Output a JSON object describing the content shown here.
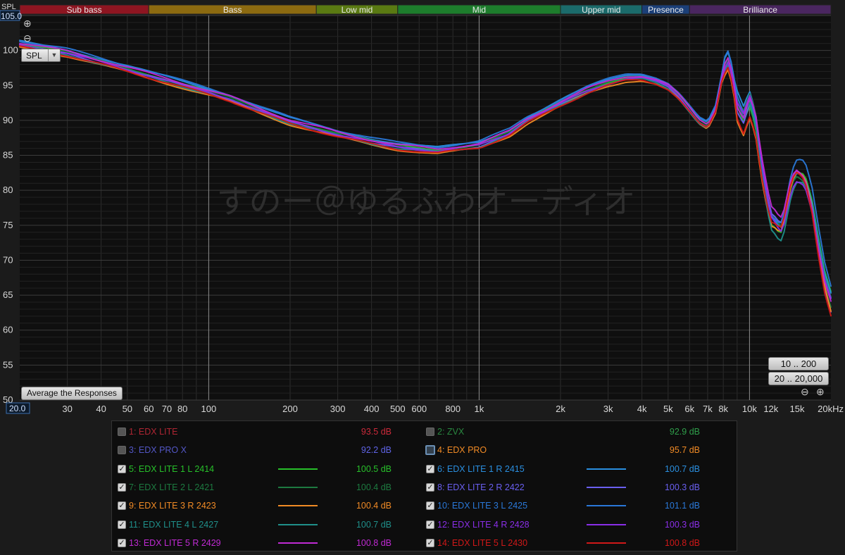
{
  "watermark": "すのー＠ゆるふわオーディオ",
  "bands": [
    {
      "label": "Sub bass",
      "from": 20,
      "to": 60,
      "color": "#8e1521"
    },
    {
      "label": "Bass",
      "from": 60,
      "to": 250,
      "color": "#8c6a10"
    },
    {
      "label": "Low mid",
      "from": 250,
      "to": 500,
      "color": "#5a7a12"
    },
    {
      "label": "Mid",
      "from": 500,
      "to": 2000,
      "color": "#1d7d2c"
    },
    {
      "label": "Upper mid",
      "from": 2000,
      "to": 4000,
      "color": "#1b6b6b"
    },
    {
      "label": "Presence",
      "from": 4000,
      "to": 6000,
      "color": "#1b3f78"
    },
    {
      "label": "Brilliance",
      "from": 6000,
      "to": 20000,
      "color": "#4a2660"
    }
  ],
  "controls": {
    "spl_label": "SPL",
    "average_button": "Average the Responses",
    "range_button_1": "10 .. 200",
    "range_button_2": "20 .. 20,000",
    "zoom_in_icon": "zoom-in-icon",
    "zoom_out_icon": "zoom-out-icon"
  },
  "chart_data": {
    "type": "line",
    "xscale": "log",
    "xlim": [
      20,
      20000
    ],
    "ylim": [
      50,
      105
    ],
    "ylabel": "SPL",
    "y_top_readout": "105.0",
    "x_left_readout": "20.0",
    "y_ticks": [
      "100",
      "95",
      "90",
      "85",
      "80",
      "75",
      "70",
      "65",
      "60",
      "55",
      "50"
    ],
    "y_tick_values": [
      100,
      95,
      90,
      85,
      80,
      75,
      70,
      65,
      60,
      55,
      50
    ],
    "x_tick_labels": [
      "30",
      "40",
      "50",
      "60",
      "70",
      "80",
      "100",
      "200",
      "300",
      "400",
      "500",
      "600",
      "800",
      "1k",
      "2k",
      "3k",
      "4k",
      "5k",
      "6k",
      "7k",
      "8k",
      "10k",
      "12k",
      "15k",
      "20kHz"
    ],
    "x_tick_values": [
      30,
      40,
      50,
      60,
      70,
      80,
      100,
      200,
      300,
      400,
      500,
      600,
      800,
      1000,
      2000,
      3000,
      4000,
      5000,
      6000,
      7000,
      8000,
      10000,
      12000,
      15000,
      20000
    ],
    "base_curve": {
      "x": [
        20,
        30,
        50,
        100,
        120,
        150,
        200,
        300,
        400,
        500,
        700,
        1000,
        1300,
        1500,
        2000,
        2500,
        3000,
        3500,
        4000,
        4500,
        5000,
        5500,
        6000,
        6500,
        7000,
        7500,
        8000,
        8300,
        8600,
        9000,
        9500,
        10000,
        10500,
        11000,
        11500,
        12000,
        12500,
        13000,
        13500,
        14000,
        14500,
        15000,
        16000,
        17000,
        18000,
        19000,
        20000
      ],
      "y": [
        100.8,
        99.6,
        97.3,
        94,
        93.1,
        91.6,
        89.8,
        88,
        86.9,
        86.2,
        85.6,
        86.4,
        88.2,
        89.9,
        92.4,
        94.2,
        95.3,
        96,
        96.1,
        95.6,
        94.8,
        93.3,
        91.5,
        89.8,
        89.1,
        91.5,
        97,
        98.5,
        96.5,
        92,
        90,
        92.5,
        90,
        84,
        79.5,
        75.8,
        75.2,
        74.2,
        76,
        79.5,
        81.5,
        82.5,
        81.8,
        78,
        72,
        67,
        64
      ]
    },
    "series": [
      {
        "id": 1,
        "name": "EDX LITE",
        "value": "93.5 dB",
        "color": "#cc2a3a",
        "visible": false,
        "offset": 0
      },
      {
        "id": 2,
        "name": "ZVX",
        "value": "92.9 dB",
        "color": "#2f9e4a",
        "visible": false,
        "offset": 0
      },
      {
        "id": 3,
        "name": "EDX PRO X",
        "value": "92.2 dB",
        "color": "#5f63e6",
        "visible": false,
        "offset": 0
      },
      {
        "id": 4,
        "name": "EDX PRO",
        "value": "95.7 dB",
        "color": "#f08a25",
        "visible": false,
        "offset": 0
      },
      {
        "id": 5,
        "name": "EDX LITE 1 L 2414",
        "value": "100.5 dB",
        "color": "#27c02a",
        "visible": true,
        "offset": 0.2
      },
      {
        "id": 6,
        "name": "EDX LITE 1 R 2415",
        "value": "100.7 dB",
        "color": "#2a8fe0",
        "visible": true,
        "offset": 0.5
      },
      {
        "id": 7,
        "name": "EDX LITE 2 L 2421",
        "value": "100.4 dB",
        "color": "#1d7a40",
        "visible": true,
        "offset": 0.1
      },
      {
        "id": 8,
        "name": "EDX LITE 2 R 2422",
        "value": "100.3 dB",
        "color": "#6a5ff0",
        "visible": true,
        "offset": -0.1
      },
      {
        "id": 9,
        "name": "EDX LITE 3 R 2423",
        "value": "100.4 dB",
        "color": "#f08a25",
        "visible": true,
        "offset": -0.4
      },
      {
        "id": 10,
        "name": "EDX LITE 3 L 2425",
        "value": "101.1 dB",
        "color": "#2a78d8",
        "visible": true,
        "offset": 0.6
      },
      {
        "id": 11,
        "name": "EDX LITE 4 L 2427",
        "value": "100.7 dB",
        "color": "#1f8f8a",
        "visible": true,
        "offset": -0.2
      },
      {
        "id": 12,
        "name": "EDX LITE 4 R 2428",
        "value": "100.3 dB",
        "color": "#8a2ee8",
        "visible": true,
        "offset": 0
      },
      {
        "id": 13,
        "name": "EDX LITE 5 R 2429",
        "value": "100.8 dB",
        "color": "#c02ad4",
        "visible": true,
        "offset": 0.3
      },
      {
        "id": 14,
        "name": "EDX LITE 5 L 2430",
        "value": "100.8 dB",
        "color": "#d01818",
        "visible": true,
        "offset": -0.3
      }
    ]
  }
}
